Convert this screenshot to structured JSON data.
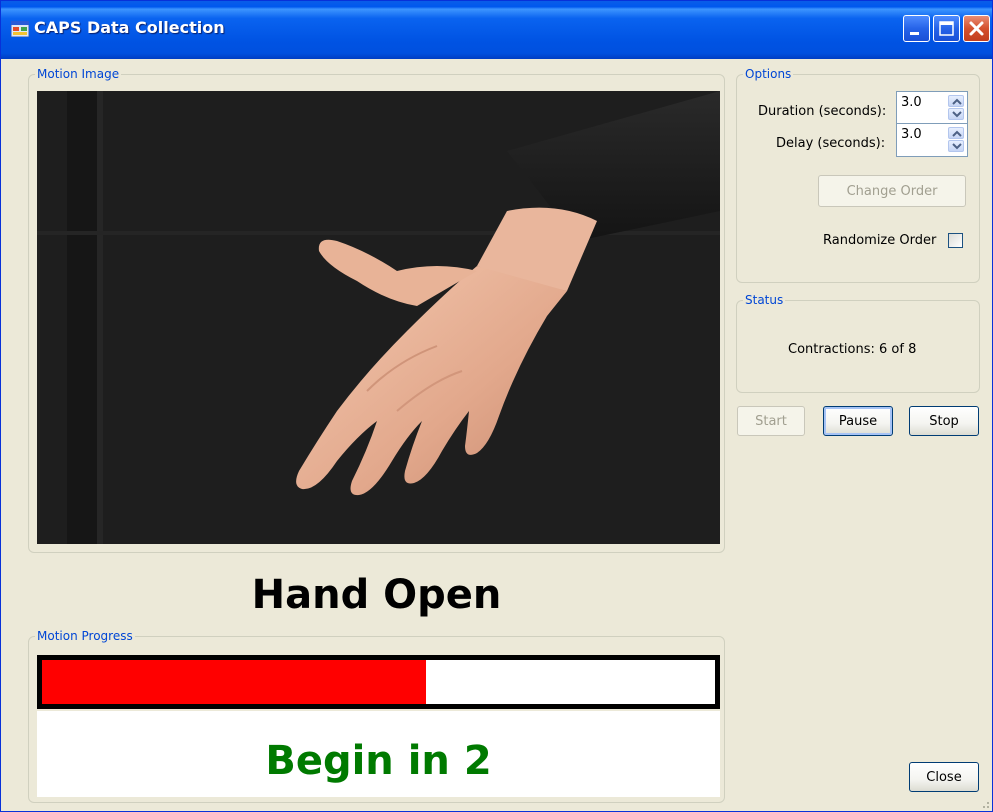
{
  "window": {
    "title": "CAPS Data Collection",
    "app_icon": "application-icon",
    "controls": [
      "minimize-icon",
      "maximize-icon",
      "close-icon"
    ]
  },
  "motion_image": {
    "legend": "Motion Image",
    "image_description_icon": "hand-photo"
  },
  "options": {
    "legend": "Options",
    "duration_label": "Duration (seconds):",
    "duration_value": "3.0",
    "delay_label": "Delay (seconds):",
    "delay_value": "3.0",
    "change_order_label": "Change Order",
    "randomize_label": "Randomize Order",
    "randomize_checked": false
  },
  "status": {
    "legend": "Status",
    "contractions_text": "Contractions: 6 of 8"
  },
  "controls": {
    "start_label": "Start",
    "pause_label": "Pause",
    "stop_label": "Stop",
    "close_label": "Close"
  },
  "motion": {
    "current_motion": "Hand Open"
  },
  "motion_progress": {
    "legend": "Motion Progress",
    "progress_fraction": 0.57,
    "fill_color": "#ff0000",
    "countdown_text": "Begin in 2",
    "countdown_color": "#007a00"
  },
  "colors": {
    "window_bg": "#ece9d8",
    "group_legend": "#0046d5",
    "titlebar": "#0054e3"
  }
}
